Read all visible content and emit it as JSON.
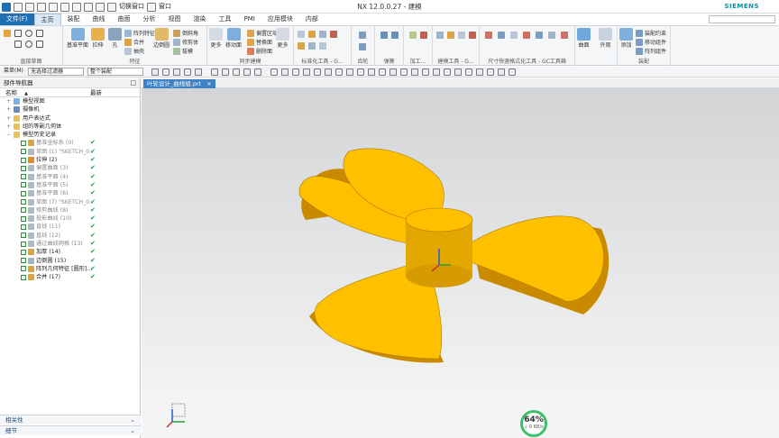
{
  "window": {
    "title": "NX 12.0.0.27 - 建模",
    "brand": "SIEMENS",
    "quick_window_label": "切换窗口",
    "window_menu_label": "窗口"
  },
  "menu_tabs": [
    "文件(F)",
    "主页",
    "装配",
    "曲线",
    "曲面",
    "分析",
    "视图",
    "渲染",
    "工具",
    "PMI",
    "应用模块",
    "内部"
  ],
  "active_tab_index": 1,
  "ribbon": {
    "groups": [
      "直接草图",
      "特征",
      "同步建模",
      "标准化工具 - G...",
      "齿轮",
      "弹簧",
      "加工...",
      "建模工具 - G...",
      "尺寸快速格式化工具 - GC工具箱",
      "装配"
    ],
    "buttons": {
      "datum_plane": "基准平面",
      "extrude": "拉伸",
      "hole": "孔",
      "array_feature": "阵列特征",
      "combine": "合并",
      "shell": "抽壳",
      "edge_blend": "边倒圆",
      "chamfer": "倒斜角",
      "trim_body": "修剪体",
      "draft": "拔模",
      "more": "更多",
      "move_face": "移动面",
      "replace_face": "替换面",
      "delete_face": "删除面",
      "offset_area": "偏置区域",
      "more2": "更多",
      "surface": "曲面",
      "appearance": "外观",
      "assembly_constraint": "装配约束",
      "move_component": "移动组件",
      "array_component": "阵列组件",
      "add": "添加"
    }
  },
  "toolbar2": {
    "menu_label": "菜单(M)",
    "filter_value": "无选择过滤器",
    "scope_value": "整个装配"
  },
  "part_navigator": {
    "title": "部件导航器",
    "col_name": "名称",
    "col_latest": "最新",
    "top_nodes": [
      "模型视图",
      "摄像机",
      "用户表达式",
      "组的等副几何体",
      "模型历史记录"
    ],
    "features": [
      {
        "label": "基准坐标系 (0)",
        "dim": true,
        "check": true
      },
      {
        "label": "草图 (1) \"SKETCH_0...",
        "dim": true,
        "check": true
      },
      {
        "label": "拉伸 (2)",
        "dim": false,
        "check": true
      },
      {
        "label": "偏置曲面 (3)",
        "dim": true,
        "check": true
      },
      {
        "label": "基准平面 (4)",
        "dim": true,
        "check": true
      },
      {
        "label": "基准平面 (5)",
        "dim": true,
        "check": true
      },
      {
        "label": "基准平面 (6)",
        "dim": true,
        "check": true
      },
      {
        "label": "草图 (7) \"SKETCH_0...",
        "dim": true,
        "check": true
      },
      {
        "label": "修剪曲线 (8)",
        "dim": true,
        "check": true
      },
      {
        "label": "投影曲线 (10)",
        "dim": true,
        "check": true
      },
      {
        "label": "直线 (11)",
        "dim": true,
        "check": true
      },
      {
        "label": "直线 (12)",
        "dim": true,
        "check": true
      },
      {
        "label": "通过曲线网格 (13)",
        "dim": true,
        "check": true
      },
      {
        "label": "加厚 (14)",
        "dim": false,
        "check": true
      },
      {
        "label": "边倒圆 (15)",
        "dim": false,
        "check": true
      },
      {
        "label": "阵列几何特征 [圆形]...",
        "dim": false,
        "check": true
      },
      {
        "label": "合并 (17)",
        "dim": false,
        "check": true
      }
    ],
    "bottom_panels": [
      "相关性",
      "细节"
    ]
  },
  "document_tab": "叶轮设计_曲线组.prt",
  "status_gauge": {
    "value": "64%",
    "rate": "↓ 0 KB/s"
  },
  "colors": {
    "accent": "#1f6fb3",
    "blade": "#ffc000",
    "blade_edge": "#c98a00"
  }
}
